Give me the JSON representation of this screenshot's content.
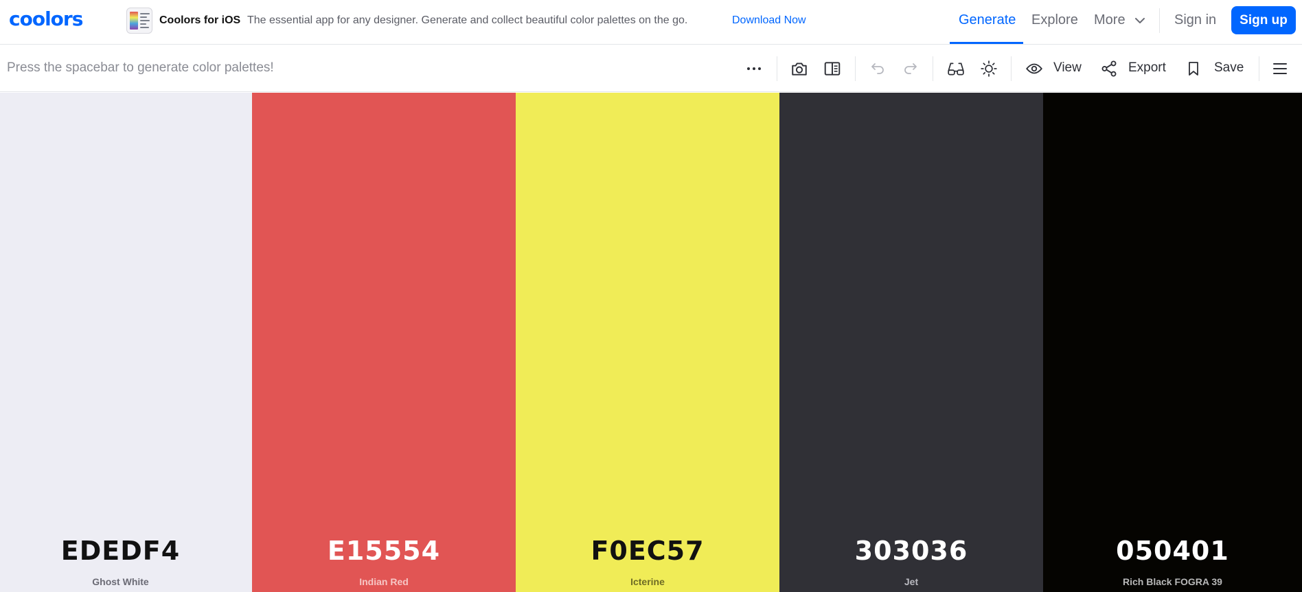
{
  "brand": {
    "logo": "coolors"
  },
  "promo": {
    "title": "Coolors for iOS",
    "text": "The essential app for any designer. Generate and collect beautiful color palettes on the go.",
    "link": "Download Now",
    "icon": "app-screenshot-icon"
  },
  "nav": {
    "generate": "Generate",
    "explore": "Explore",
    "more": "More",
    "sign_in": "Sign in",
    "sign_up": "Sign up",
    "accent": "#0066ff"
  },
  "toolbar": {
    "hint": "Press the spacebar to generate color palettes!",
    "view_label": "View",
    "export_label": "Export",
    "save_label": "Save",
    "icons": [
      "more-dots-icon",
      "camera-icon",
      "split-panel-icon",
      "undo-icon",
      "redo-icon",
      "glasses-icon",
      "sun-icon",
      "eye-icon",
      "share-icon",
      "bookmark-icon",
      "menu-icon"
    ]
  },
  "palette": [
    {
      "hex": "EDEDF4",
      "name": "Ghost White",
      "bg": "#EDEDF4",
      "text_color": "#111111",
      "name_color": "#6b6b75"
    },
    {
      "hex": "E15554",
      "name": "Indian Red",
      "bg": "#E15554",
      "text_color": "#ffffff",
      "name_color": "#f6c6c5"
    },
    {
      "hex": "F0EC57",
      "name": "Icterine",
      "bg": "#F0EC57",
      "text_color": "#111111",
      "name_color": "#6e6b25"
    },
    {
      "hex": "303036",
      "name": "Jet",
      "bg": "#303036",
      "text_color": "#ffffff",
      "name_color": "#b9b9c0"
    },
    {
      "hex": "050401",
      "name": "Rich Black FOGRA 39",
      "bg": "#050401",
      "text_color": "#ffffff",
      "name_color": "#b8b8b8"
    }
  ]
}
